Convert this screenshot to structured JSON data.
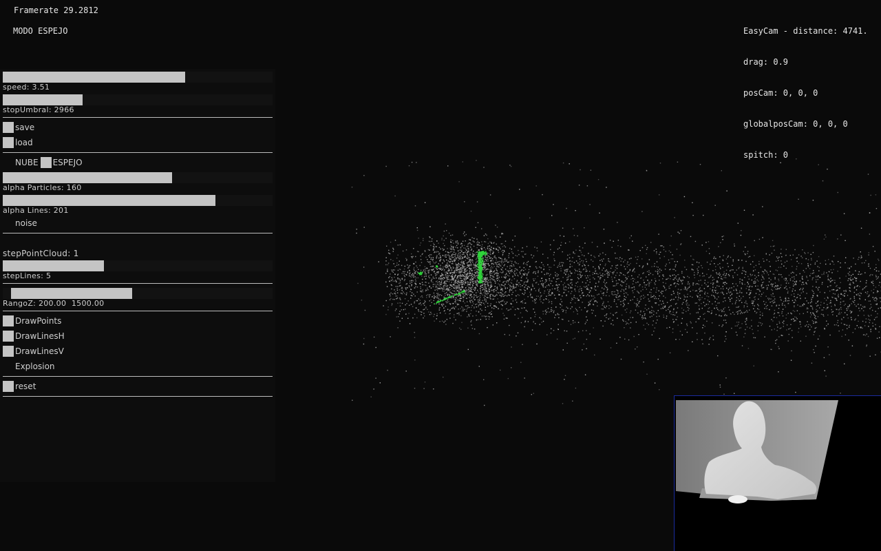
{
  "hud": {
    "framerate": "Framerate 29.2812",
    "mode": "MODO ESPEJO",
    "camera": [
      "EasyCam - distance: 4741.",
      "drag: 0.9",
      "posCam: 0, 0, 0",
      "globalposCam: 0, 0, 0",
      "spitch: 0"
    ]
  },
  "gui": {
    "speed": {
      "label": "speed: 3.51",
      "level": 0.675
    },
    "stopUmbral": {
      "label": "stopUmbral: 2966",
      "level": 0.296
    },
    "save": {
      "label": "save",
      "checked": true
    },
    "load": {
      "label": "load",
      "checked": true
    },
    "mode_toggle": {
      "left_label": "NUBE",
      "right_label": "ESPEJO",
      "checked": true
    },
    "alphaParticles": {
      "label": "alpha Particles: 160",
      "level": 0.627
    },
    "alphaLines": {
      "label": "alpha Lines: 201",
      "level": 0.788
    },
    "noise": {
      "label": "noise",
      "checked": false
    },
    "stepPointCloud": {
      "label": "stepPointCloud: 1"
    },
    "stepLines": {
      "label": "stepLines: 5",
      "level": 0.375
    },
    "rangoZ": {
      "label": "RangoZ: 200.00  1500.00",
      "low": 0.03,
      "high": 0.48
    },
    "drawPoints": {
      "label": "DrawPoints",
      "checked": true
    },
    "drawLinesH": {
      "label": "DrawLinesH",
      "checked": true
    },
    "drawLinesV": {
      "label": "DrawLinesV",
      "checked": true
    },
    "explosion": {
      "label": "Explosion",
      "checked": false
    },
    "reset": {
      "label": "reset",
      "checked": true
    }
  },
  "colors": {
    "background": "#0a0a0a",
    "points": "#bfbfbf",
    "highlight": "#2fd43a",
    "slider_fill": "#c4c4c4",
    "depth_border": "#1b2ca0"
  }
}
